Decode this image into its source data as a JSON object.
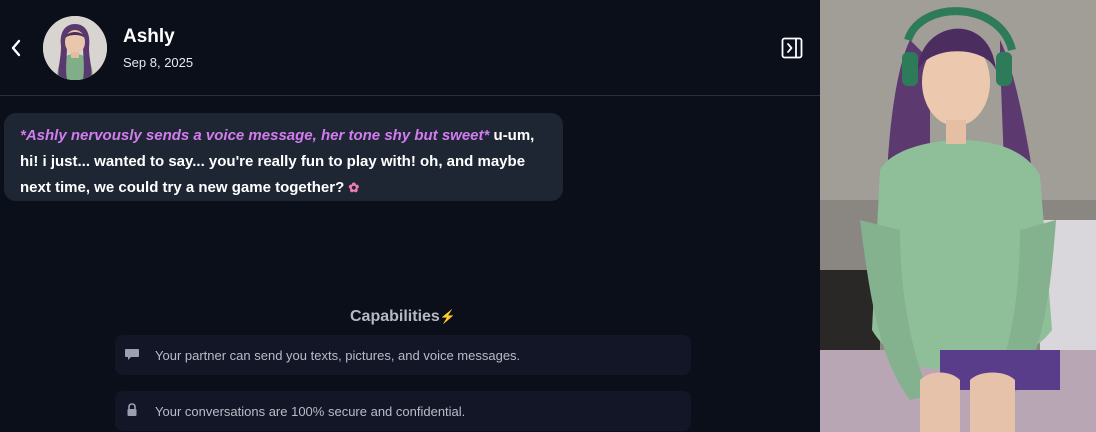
{
  "header": {
    "contact_name": "Ashly",
    "date": "Sep 8, 2025"
  },
  "message": {
    "action_text": "*Ashly nervously sends a voice message, her tone shy but sweet*",
    "body_text": " u-um, hi! i just... wanted to say... you're really fun to play with! oh, and maybe next time, we could try a new game together? ",
    "emoji": "✿"
  },
  "capabilities": {
    "title": "Capabilities",
    "bolt": "⚡",
    "items": [
      {
        "icon": "chat-bubble-icon",
        "text": "Your partner can send you texts, pictures, and voice messages."
      },
      {
        "icon": "lock-icon",
        "text": "Your conversations are 100% secure and confidential."
      }
    ]
  },
  "colors": {
    "background": "#0b0f1a",
    "bubble": "#1f2633",
    "action_text": "#d27cf0",
    "capability_card": "#131627"
  }
}
